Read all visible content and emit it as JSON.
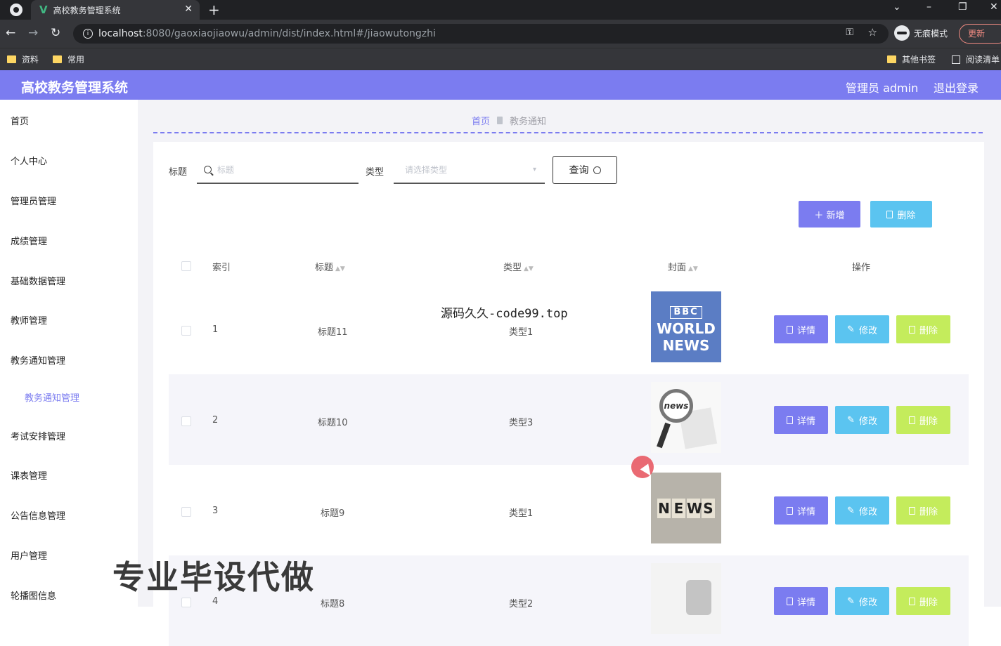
{
  "browser": {
    "tab_title": "高校教务管理系统",
    "tab_logo": "V",
    "tab_close": "✕",
    "new_tab": "+",
    "url_host": "localhost",
    "url_path": ":8080/gaoxiaojiaowu/admin/dist/index.html#/jiaowutongzhi",
    "incognito_label": "无痕模式",
    "update_label": "更新",
    "bookmarks": [
      "资料",
      "常用"
    ],
    "other_bookmarks": "其他书签",
    "reading_list": "阅读清单"
  },
  "header": {
    "app_title": "高校教务管理系统",
    "admin_label": "管理员 admin",
    "logout_label": "退出登录"
  },
  "sidebar": {
    "items": [
      {
        "label": "首页"
      },
      {
        "label": "个人中心"
      },
      {
        "label": "管理员管理"
      },
      {
        "label": "成绩管理"
      },
      {
        "label": "基础数据管理"
      },
      {
        "label": "教师管理"
      },
      {
        "label": "教务通知管理"
      },
      {
        "label": "教务通知管理"
      },
      {
        "label": "考试安排管理"
      },
      {
        "label": "课表管理"
      },
      {
        "label": "公告信息管理"
      },
      {
        "label": "用户管理"
      },
      {
        "label": "轮播图信息"
      }
    ]
  },
  "breadcrumb": {
    "home": "首页",
    "current": "教务通知"
  },
  "search": {
    "title_label": "标题",
    "title_placeholder": "标题",
    "type_label": "类型",
    "type_placeholder": "请选择类型",
    "query_label": "查询"
  },
  "actions": {
    "add_label": "＋ 新增",
    "batch_delete_label": "删除"
  },
  "table": {
    "columns": {
      "index": "索引",
      "title": "标题",
      "type": "类型",
      "cover": "封面",
      "ops": "操作"
    },
    "rows": [
      {
        "index": "1",
        "title": "标题11",
        "type": "类型1",
        "cover": "bbc-world-news"
      },
      {
        "index": "2",
        "title": "标题10",
        "type": "类型3",
        "cover": "magnifier-news"
      },
      {
        "index": "3",
        "title": "标题9",
        "type": "类型1",
        "cover": "news-blocks"
      },
      {
        "index": "4",
        "title": "标题8",
        "type": "类型2",
        "cover": "figure"
      }
    ],
    "ops": {
      "detail": "详情",
      "edit": "修改",
      "delete": "删除"
    }
  },
  "cover_texts": {
    "bbc": "BBC",
    "world": "WORLD",
    "news": "NEWS",
    "lens": "news",
    "letters": [
      "N",
      "E",
      "W",
      "S"
    ]
  },
  "overlay": {
    "watermark_center": "源码久久-code99.top",
    "promo_text": "专业毕设代做"
  },
  "colors": {
    "primary": "#7b7cf0",
    "edit": "#5bc4f0",
    "delete": "#c4ec5c"
  }
}
